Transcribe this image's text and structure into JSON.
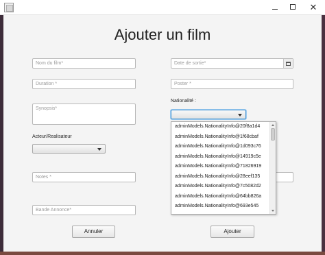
{
  "window": {
    "title": ""
  },
  "form": {
    "heading": "Ajouter un film",
    "nom_placeholder": "Nom du film*",
    "date_placeholder": "Date de sortie*",
    "duration_placeholder": "Duration *",
    "poster_placeholder": "Poster *",
    "synopsis_placeholder": "Synopsis*",
    "nationalite_label": "Nationalité :",
    "acteur_label": "Acteur/Realisateur",
    "notes_placeholder": "Notes *",
    "bande_placeholder": "Bande Annonce*",
    "annuler_label": "Annuler",
    "ajouter_label": "Ajouter"
  },
  "nationality_options": [
    "adminModels.NationalityInfo@20f8a1d4",
    "adminModels.NationalityInfo@1f68cbaf",
    "adminModels.NationalityInfo@1d093c76",
    "adminModels.NationalityInfo@14919c5e",
    "adminModels.NationalityInfo@71826919",
    "adminModels.NationalityInfo@28eef135",
    "adminModels.NationalityInfo@7c5082d2",
    "adminModels.NationalityInfo@64bb826a",
    "adminModels.NationalityInfo@693e545"
  ],
  "colors": {
    "focus": "#3b8fd1",
    "background": "#f4f4f4"
  }
}
